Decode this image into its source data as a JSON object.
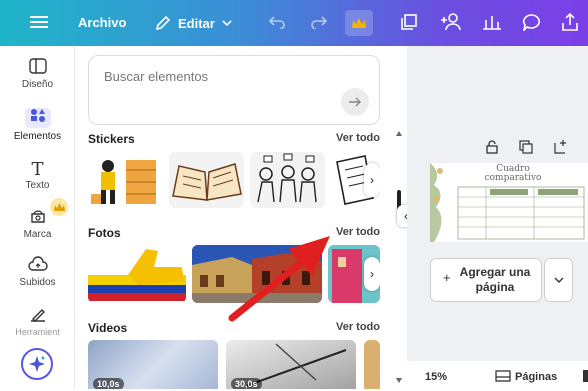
{
  "topbar": {
    "file_label": "Archivo",
    "edit_label": "Editar"
  },
  "sidebar": {
    "items": [
      {
        "label": "Diseño"
      },
      {
        "label": "Elementos"
      },
      {
        "label": "Texto"
      },
      {
        "label": "Marca"
      },
      {
        "label": "Subidos"
      },
      {
        "label": "Herramient"
      }
    ]
  },
  "panel": {
    "search_placeholder": "Buscar elementos",
    "sections": [
      {
        "title": "Stickers",
        "see_all": "Ver todo"
      },
      {
        "title": "Fotos",
        "see_all": "Ver todo"
      },
      {
        "title": "Videos",
        "see_all": "Ver todo"
      }
    ],
    "video_durations": [
      "10,0s",
      "30,0s"
    ]
  },
  "right": {
    "page_thumb_title": "Cuadro comparativo",
    "add_page_label": "Agregar una página",
    "zoom": "15%",
    "pages_label": "Páginas"
  },
  "colors": {
    "accent": "#7b3fe8",
    "teal": "#1fb5c9",
    "arrow": "#e02020"
  }
}
